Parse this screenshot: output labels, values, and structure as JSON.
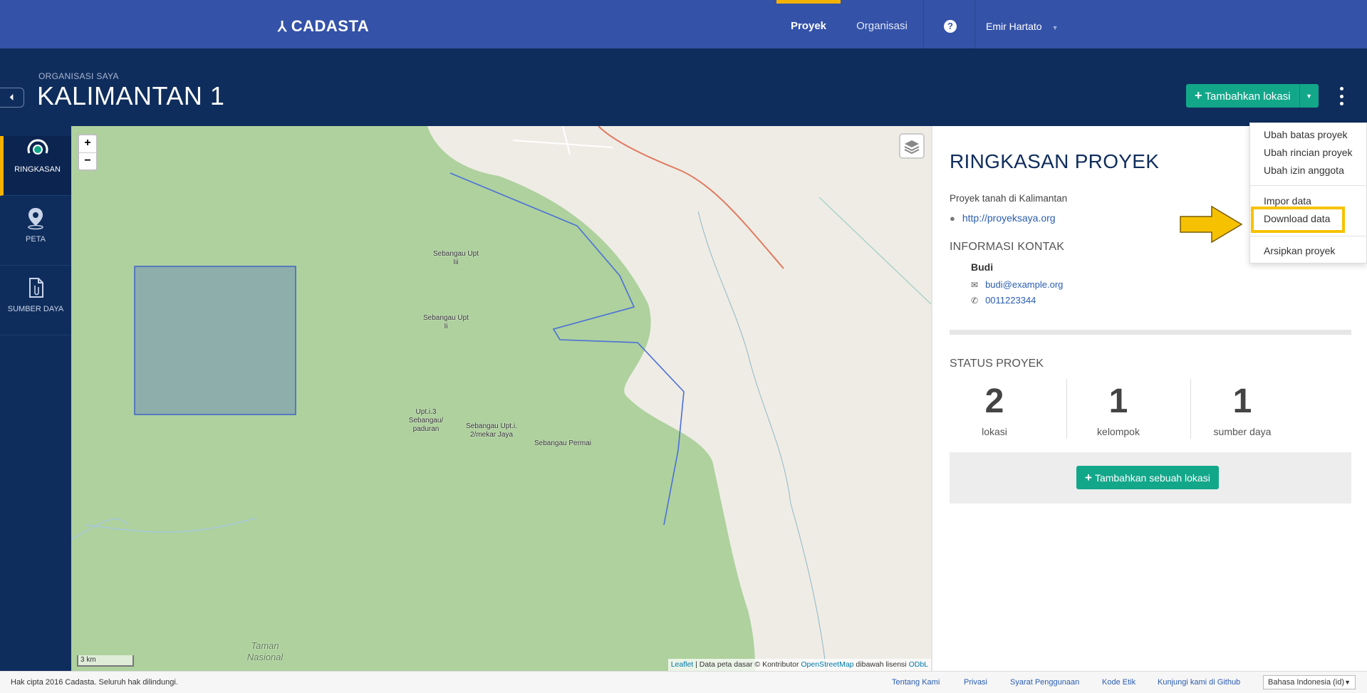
{
  "app": {
    "brand": "CADASTA",
    "logo_icon": "cadasta-logo-icon"
  },
  "topnav": {
    "projects": "Proyek",
    "organizations": "Organisasi",
    "help_icon": "question-icon",
    "user": "Emir Hartato"
  },
  "header": {
    "org_label": "ORGANISASI SAYA",
    "project_title": "KALIMANTAN 1",
    "add_location": "Tambahkan lokasi"
  },
  "sidebar": {
    "items": [
      {
        "label": "RINGKASAN",
        "icon": "dashboard-icon",
        "active": true
      },
      {
        "label": "PETA",
        "icon": "map-pin-icon",
        "active": false
      },
      {
        "label": "SUMBER DAYA",
        "icon": "document-icon",
        "active": false
      }
    ]
  },
  "map": {
    "zoom_in": "+",
    "zoom_out": "−",
    "scale": "3 km",
    "labels": [
      "Sebangau Upt Iii",
      "Sebangau Upt Ii",
      "Upt.i.3 Sebangau/ paduran",
      "Sebangau Upt.i. 2/mekar Jaya",
      "Sebangau Permai",
      "Taman Nasional"
    ],
    "attribution": {
      "leaflet": "Leaflet",
      "text1": " | Data peta dasar © Kontributor ",
      "osm": "OpenStreetMap",
      "text2": " dibawah lisensi ",
      "odbl": "ODbL"
    }
  },
  "summary": {
    "title": "RINGKASAN PROYEK",
    "description": "Proyek tanah di Kalimantan",
    "url": "http://proyeksaya.org",
    "contact_heading": "INFORMASI KONTAK",
    "contact_name": "Budi",
    "contact_email": "budi@example.org",
    "contact_phone": "0011223344",
    "status_heading": "STATUS PROYEK",
    "stats": [
      {
        "value": "2",
        "label": "lokasi"
      },
      {
        "value": "1",
        "label": "kelompok"
      },
      {
        "value": "1",
        "label": "sumber daya"
      }
    ],
    "add_single_location": "Tambahkan sebuah lokasi"
  },
  "dropdown": {
    "items": [
      "Ubah batas proyek",
      "Ubah rincian proyek",
      "Ubah izin anggota",
      "Impor data",
      "Download data",
      "Arsipkan proyek"
    ],
    "highlighted": "Download data"
  },
  "footer": {
    "copyright": "Hak cipta 2016 Cadasta. Seluruh hak dilindungi.",
    "links": [
      "Tentang Kami",
      "Privasi",
      "Syarat Penggunaan",
      "Kode Etik",
      "Kunjungi kami di Github"
    ],
    "language": "Bahasa Indonesia (id)"
  },
  "colors": {
    "nav": "#3452a8",
    "header": "#0f2d5c",
    "accent": "#f6b100",
    "primary_button": "#13a78a",
    "map_park": "#aed19e",
    "parcel_fill": "#8daeaa"
  }
}
